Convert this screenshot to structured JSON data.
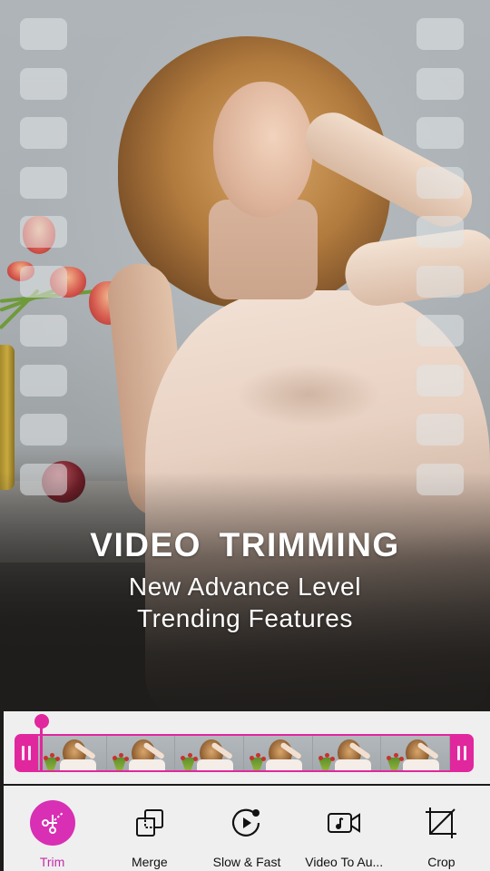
{
  "hero": {
    "title": "VIDEO  TRIMMING",
    "subtitle_line1": "New Advance Level",
    "subtitle_line2": "Trending Features",
    "sprocket_holes_per_side": 10
  },
  "timeline": {
    "frame_count": 6,
    "playhead_position_percent": 5,
    "accent_color": "#e1279d",
    "left_handle_icon": "pause-bars-icon",
    "right_handle_icon": "pause-bars-icon"
  },
  "toolbar": {
    "active_color": "#d82fb4",
    "items": [
      {
        "id": "trim",
        "label": "Trim",
        "icon": "scissors-icon",
        "active": true
      },
      {
        "id": "merge",
        "label": "Merge",
        "icon": "merge-squares-icon",
        "active": false
      },
      {
        "id": "slow-fast",
        "label": "Slow & Fast",
        "icon": "speed-play-icon",
        "active": false
      },
      {
        "id": "video-to-audio",
        "label": "Video To Au...",
        "icon": "video-music-icon",
        "active": false
      },
      {
        "id": "crop",
        "label": "Crop",
        "icon": "crop-icon",
        "active": false
      }
    ]
  }
}
